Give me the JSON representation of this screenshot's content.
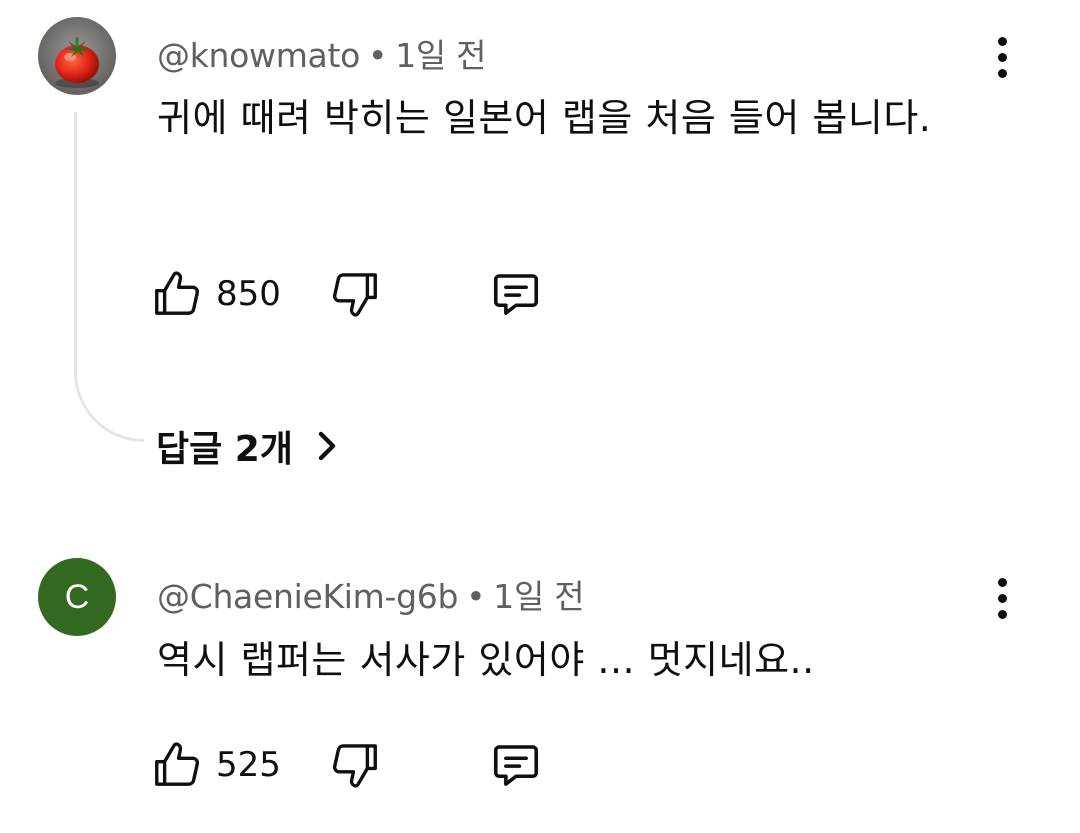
{
  "comments": [
    {
      "author": "@knowmato",
      "separator": "•",
      "time": "1일 전",
      "avatar_icon": "tomato-avatar",
      "text": "귀에 때려 박히는 일본어 랩을 처음 들어 봅니다.",
      "likes": "850",
      "replies_label": "답글 2개"
    },
    {
      "author": "@ChaenieKim-g6b",
      "separator": "•",
      "time": "1일 전",
      "avatar_letter": "C",
      "avatar_color": "#33691e",
      "text": "역시 랩퍼는 서사가 있어야 ... 멋지네요..",
      "likes": "525"
    }
  ],
  "colors": {
    "text_primary": "#0f0f0f",
    "text_secondary": "#606060",
    "thread_line": "#e5e5e5"
  },
  "icons": [
    "thumb-up-icon",
    "thumb-down-icon",
    "reply-icon",
    "more-vert-icon",
    "chevron-right-icon"
  ]
}
